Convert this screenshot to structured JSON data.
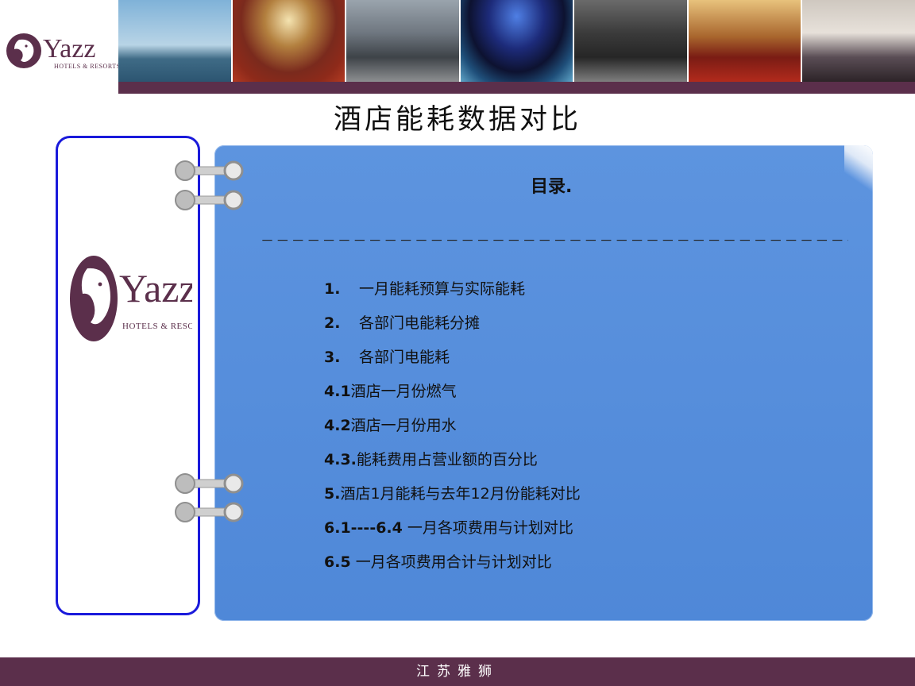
{
  "brand": {
    "name": "Yazz",
    "tagline": "HOTELS & RESORTS",
    "color": "#5b2f4b"
  },
  "banner": {
    "photos": [
      "cruise-ship-photo",
      "ballroom-photo",
      "lobby-photo",
      "nightclub-photo",
      "corridor-photo",
      "banquet-hall-photo",
      "guest-room-photo"
    ]
  },
  "page": {
    "title": "酒店能耗数据对比"
  },
  "toc": {
    "heading": "目录.",
    "divider": "－－－－－－－－－－－－－－－－－－－－－－－－－－－－－－－－－－－－－－－－－－－－",
    "items": [
      {
        "num": "1.",
        "text": "一月能耗预算与实际能耗"
      },
      {
        "num": "2.",
        "text": "各部门电能耗分摊"
      },
      {
        "num": "3.",
        "text": "各部门电能耗"
      },
      {
        "num": "4.1",
        "text": "酒店一月份燃气"
      },
      {
        "num": "4.2",
        "text": "酒店一月份用水"
      },
      {
        "num": "4.3.",
        "text": "能耗费用占营业额的百分比"
      },
      {
        "num": "5.",
        "text": "酒店1月能耗与去年12月份能耗对比"
      },
      {
        "num": "6.1----6.4",
        "text": " 一月各项费用与计划对比"
      },
      {
        "num": "6.5",
        "text": " 一月各项费用合计与计划对比"
      }
    ]
  },
  "footer": {
    "text": "江苏雅狮"
  },
  "colors": {
    "panel_blue": "#5189d9",
    "frame_blue": "#1a1adb",
    "accent_purple": "#5b2f4b"
  }
}
